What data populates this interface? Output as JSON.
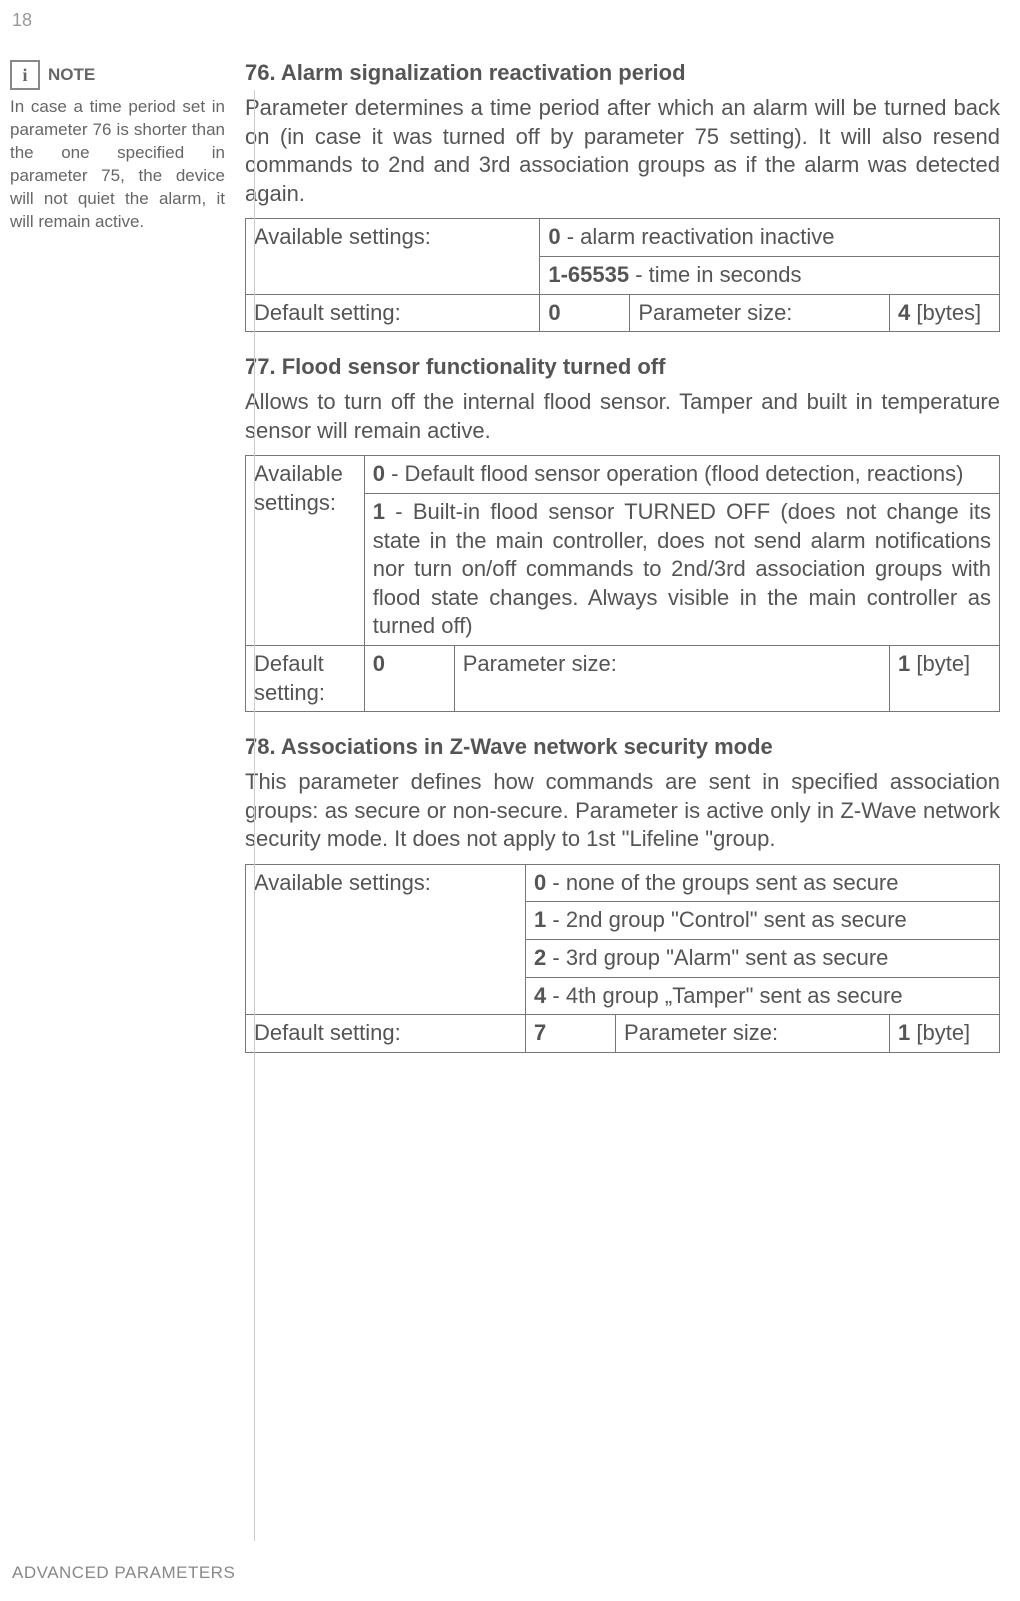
{
  "page_number": "18",
  "note": {
    "icon": "i",
    "label": "NOTE",
    "text": "In case a time period set in parameter 76 is shorter than the one specified in parameter 75, the device will not quiet the alarm, it will remain active."
  },
  "sections": [
    {
      "heading": "76. Alarm signalization reactivation period",
      "body": "Parameter determines a time period after which an alarm will be turned back on (in case it was turned off by parameter 75 setting). It will also resend commands to 2nd and 3rd association groups as if the alarm was detected again.",
      "avail_label": "Available settings:",
      "avail_rows": [
        {
          "b": "0",
          "t": " - alarm reactivation inactive"
        },
        {
          "b": "1-65535",
          "t": " - time in seconds"
        }
      ],
      "default_label": "Default setting:",
      "default_value": "0",
      "psize_label": "Parameter size:",
      "psize_value_b": "4",
      "psize_value_t": " [bytes]"
    },
    {
      "heading": "77. Flood sensor functionality turned off",
      "body": "Allows to turn off the internal flood sensor. Tamper and built in temperature sensor will remain active.",
      "avail_label": "Available settings:",
      "avail_rows": [
        {
          "b": "0",
          "t": " - Default flood sensor operation (flood detection, reactions)"
        },
        {
          "b": "1",
          "t": " - Built-in flood sensor TURNED OFF (does not change its state in the main controller, does not send alarm notifications nor turn on/off commands to 2nd/3rd association groups with flood state changes. Always visible in the main controller as turned off)"
        }
      ],
      "default_label": "Default setting:",
      "default_value": "0",
      "psize_label": "Parameter size:",
      "psize_value_b": "1",
      "psize_value_t": " [byte]"
    },
    {
      "heading": "78. Associations in Z-Wave network security mode",
      "body": "This parameter defines how commands are sent in specified association groups: as secure or non-secure. Parameter is active only in Z-Wave network security mode. It does not apply to 1st \"Lifeline \"group.",
      "avail_label": "Available settings:",
      "avail_rows": [
        {
          "b": "0",
          "t": " - none of the groups sent as secure"
        },
        {
          "b": "1",
          "t": " - 2nd group \"Control\" sent as secure"
        },
        {
          "b": "2",
          "t": " - 3rd group \"Alarm\" sent as secure"
        },
        {
          "b": "4",
          "t": " - 4th group „Tamper\" sent as secure"
        }
      ],
      "default_label": "Default setting:",
      "default_value": "7",
      "psize_label": "Parameter size:",
      "psize_value_b": "1",
      "psize_value_t": " [byte]"
    }
  ],
  "footer": "ADVANCED PARAMETERS"
}
